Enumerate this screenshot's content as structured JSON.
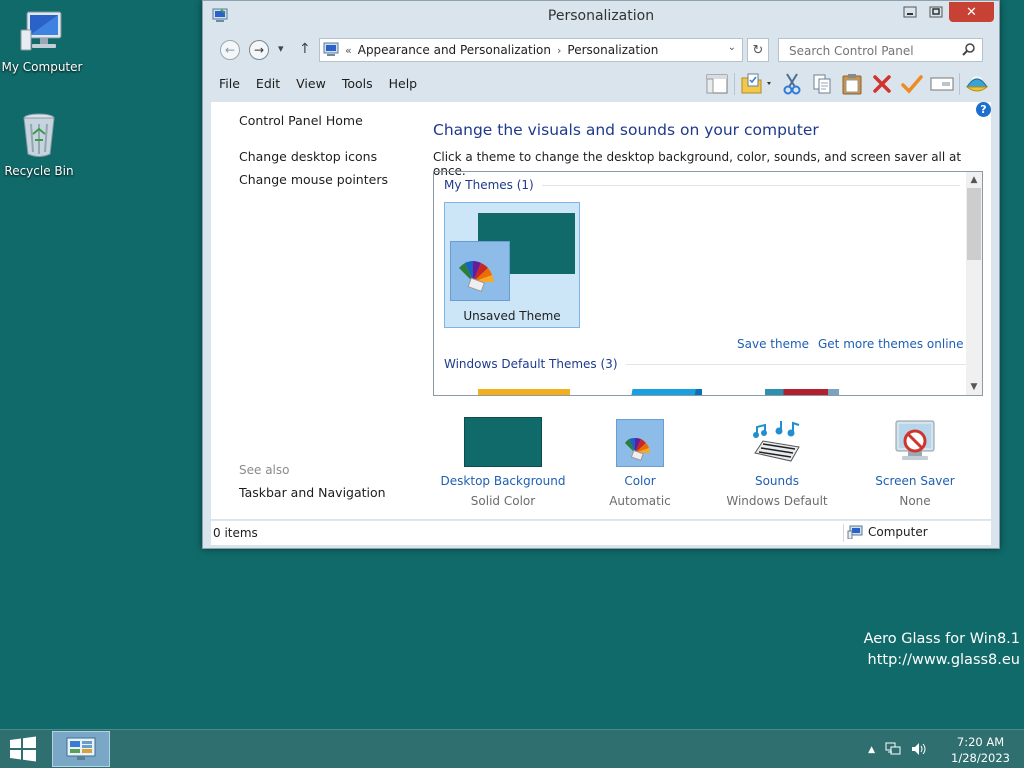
{
  "desktop": {
    "icons": [
      {
        "label": "My Computer"
      },
      {
        "label": "Recycle Bin"
      }
    ],
    "watermark_line1": "Aero Glass for Win8.1",
    "watermark_line2": "http://www.glass8.eu"
  },
  "window": {
    "title": "Personalization",
    "caption": {
      "minimize": "‒",
      "maximize": "☐",
      "close": "✕"
    },
    "nav": {
      "back": "←",
      "forward": "→",
      "recent": "▾",
      "up": "↑",
      "breadcrumb": [
        "Appearance and Personalization",
        "Personalization"
      ],
      "breadcrumb_prefix": "«",
      "separator": "›",
      "refresh": "↻"
    },
    "search": {
      "placeholder": "Search Control Panel"
    },
    "menu": [
      "File",
      "Edit",
      "View",
      "Tools",
      "Help"
    ],
    "toolbar_icons": [
      "layout-icon",
      "properties-icon",
      "cut-icon",
      "copy-icon",
      "paste-icon",
      "delete-icon",
      "apply-check-icon",
      "rename-icon",
      "globe-icon"
    ],
    "left_pane": {
      "home": "Control Panel Home",
      "links": [
        "Change desktop icons",
        "Change mouse pointers"
      ],
      "see_also": "See also",
      "see_also_links": [
        "Taskbar and Navigation"
      ]
    },
    "help": "?",
    "heading": "Change the visuals and sounds on your computer",
    "subtext": "Click a theme to change the desktop background, color, sounds, and screen saver all at once.",
    "my_themes_header": "My Themes (1)",
    "current_theme": "Unsaved Theme",
    "save_theme": "Save theme",
    "get_more_themes": "Get more themes online",
    "default_themes_header": "Windows Default Themes (3)",
    "options": [
      {
        "label": "Desktop Background",
        "sub": "Solid Color"
      },
      {
        "label": "Color",
        "sub": "Automatic"
      },
      {
        "label": "Sounds",
        "sub": "Windows Default"
      },
      {
        "label": "Screen Saver",
        "sub": "None"
      }
    ],
    "status": {
      "items": "0 items",
      "location": "Computer"
    }
  },
  "taskbar": {
    "time": "7:20 AM",
    "date": "1/28/2023",
    "tray_arrow": "▲"
  },
  "colors": {
    "desktop": "#106a6a",
    "link": "#1e5fb4",
    "heading": "#1e3a8c",
    "close": "#c74234",
    "selection": "#cde6f7"
  }
}
